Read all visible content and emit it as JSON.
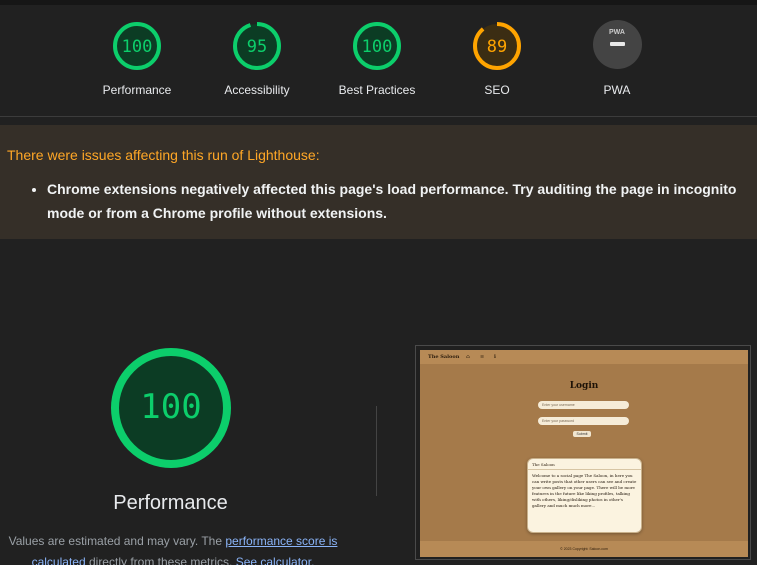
{
  "colors": {
    "pass": "#0cce6b",
    "pass_fill": "#0c3c24",
    "average": "#ffa400",
    "average_fill": "#3b2d13",
    "warning_text": "#ffa726",
    "link": "#8ab4f8"
  },
  "gauges": [
    {
      "label": "Performance",
      "score": "100",
      "fraction": 1.0
    },
    {
      "label": "Accessibility",
      "score": "95",
      "fraction": 0.95
    },
    {
      "label": "Best Practices",
      "score": "100",
      "fraction": 1.0
    },
    {
      "label": "SEO",
      "score": "89",
      "fraction": 0.89
    },
    {
      "label": "PWA",
      "badge_text": "PWA"
    }
  ],
  "warning": {
    "title": "There were issues affecting this run of Lighthouse:",
    "item": "Chrome extensions negatively affected this page's load performance. Try auditing the page in incognito mode or from a Chrome profile without extensions."
  },
  "performance": {
    "score": "100",
    "title": "Performance",
    "note_prefix": "Values are estimated and may vary. The ",
    "note_link1": "performance score is calculated",
    "note_middle": " directly from these metrics. ",
    "note_link2": "See calculator."
  },
  "screenshot": {
    "nav_title": "The Saloon",
    "nav_items": [
      "⌂",
      "≡",
      "ℹ"
    ],
    "login_title": "Login",
    "username_placeholder": "Enter your username",
    "password_placeholder": "Enter your password",
    "submit_label": "Submit",
    "card_title": "The Saloon",
    "card_body": "Welcome to a social page The Saloon, in here you can write posts that other users can see and create your own gallery on your page. There will be more features in the future like liking profiles, talking with others, liking/disliking photos in other's gallery and much much more...",
    "footer": "© 2023 Copyright: Saloon.com"
  }
}
